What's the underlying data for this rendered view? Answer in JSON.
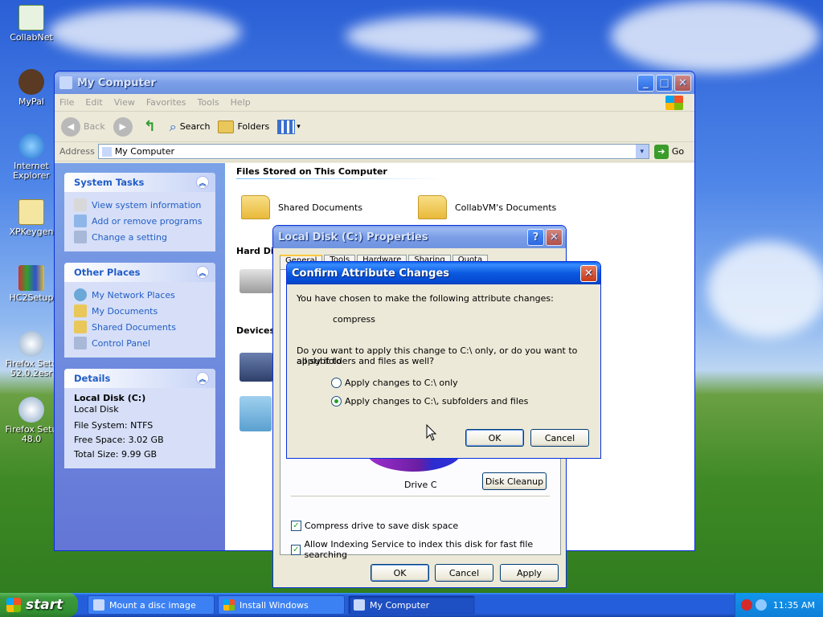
{
  "desktop": {
    "icons": [
      {
        "label": "CollabNet"
      },
      {
        "label": "MyPal"
      },
      {
        "label": "Internet Explorer"
      },
      {
        "label": "XPKeygen"
      },
      {
        "label": "HC2Setup"
      },
      {
        "label": "Firefox Setu 52.0.2esr"
      },
      {
        "label": "Firefox Setu 48.0"
      }
    ]
  },
  "mycomputer": {
    "title": "My Computer",
    "menu": [
      "File",
      "Edit",
      "View",
      "Favorites",
      "Tools",
      "Help"
    ],
    "toolbar": {
      "back": "Back",
      "search": "Search",
      "folders": "Folders"
    },
    "address": {
      "label": "Address",
      "value": "My Computer",
      "go": "Go"
    },
    "system_tasks": {
      "title": "System Tasks",
      "items": [
        "View system information",
        "Add or remove programs",
        "Change a setting"
      ]
    },
    "other_places": {
      "title": "Other Places",
      "items": [
        "My Network Places",
        "My Documents",
        "Shared Documents",
        "Control Panel"
      ]
    },
    "details": {
      "title": "Details",
      "name": "Local Disk (C:)",
      "type": "Local Disk",
      "filesystem": "File System: NTFS",
      "free": "Free Space: 3.02 GB",
      "total": "Total Size: 9.99 GB"
    },
    "sections": {
      "files": "Files Stored on This Computer",
      "hdd": "Hard Disk",
      "devices": "Devices"
    },
    "folders": [
      "Shared Documents",
      "CollabVM's Documents"
    ]
  },
  "properties": {
    "title": "Local Disk (C:) Properties",
    "tabs": [
      "General",
      "Tools",
      "Hardware",
      "Sharing",
      "Quota"
    ],
    "drive_label": "Drive C",
    "disk_cleanup": "Disk Cleanup",
    "compress": "Compress drive to save disk space",
    "indexing": "Allow Indexing Service to index this disk for fast file searching",
    "ok": "OK",
    "cancel": "Cancel",
    "apply": "Apply"
  },
  "confirm": {
    "title": "Confirm Attribute Changes",
    "intro": "You have chosen to make the following attribute changes:",
    "change": "compress",
    "question_line1": "Do you want to apply this change to C:\\ only, or do you want to apply it to",
    "question_line2": "all subfolders and files as well?",
    "option1": "Apply changes to C:\\ only",
    "option2": "Apply changes to C:\\, subfolders and files",
    "ok": "OK",
    "cancel": "Cancel"
  },
  "taskbar": {
    "start": "start",
    "tasks": [
      "Mount a disc image",
      "Install Windows",
      "My Computer"
    ],
    "clock": "11:35 AM"
  },
  "colors": {
    "xp_blue": "#0b5ae0",
    "task_link": "#215dc6",
    "start_green": "#3c9a3c"
  }
}
